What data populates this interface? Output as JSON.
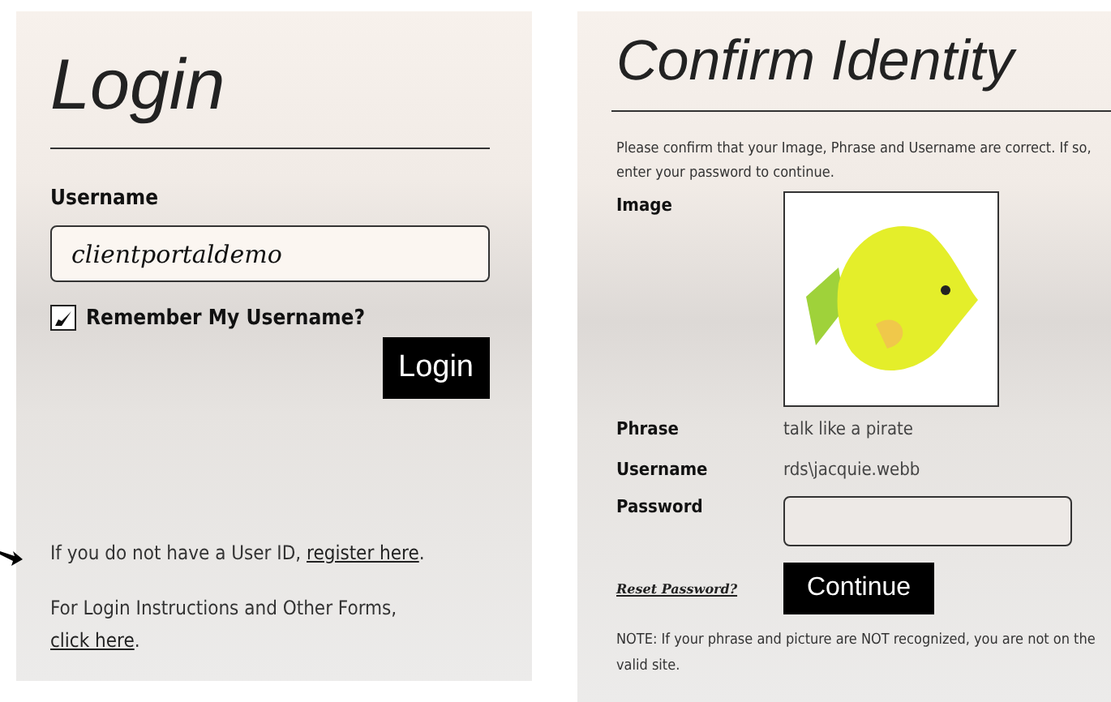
{
  "login": {
    "title": "Login",
    "username_label": "Username",
    "username_value": "clientportaldemo",
    "remember": {
      "label": "Remember My Username?",
      "checked": true
    },
    "button": "Login",
    "register_note": {
      "text": "If you do not have a User ID, ",
      "link": "register here",
      "after": "."
    },
    "forms_note": {
      "text": "For Login Instructions and Other Forms, ",
      "link": "click here",
      "after": "."
    }
  },
  "confirm": {
    "title": "Confirm Identity",
    "intro": "Please confirm that your Image, Phrase and Username are correct. If so, enter your password to continue.",
    "image_label": "Image",
    "fields": [
      {
        "label": "Phrase",
        "value": "talk like a pirate"
      },
      {
        "label": "Username",
        "value": "rds\\jacquie.webb"
      }
    ],
    "password_label": "Password",
    "reset_link": "Reset Password?",
    "button": "Continue",
    "note": "NOTE: If your phrase and picture are NOT recognized, you are not on the valid site."
  }
}
